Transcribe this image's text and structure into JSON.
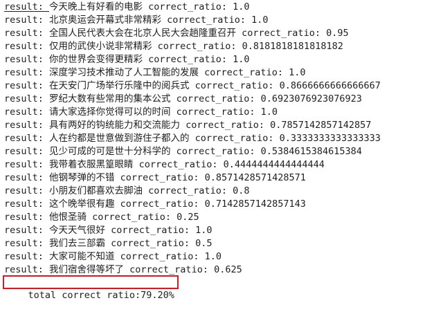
{
  "prefix": "result: ",
  "lines": [
    {
      "text": "今天晚上有好看的电影 correct_ratio: 1.0"
    },
    {
      "text": "北京奥运会开幕式非常精彩 correct_ratio: 1.0"
    },
    {
      "text": "全国人民代表大会在北京人民大会趟隆重召开 correct_ratio: 0.95"
    },
    {
      "text": "仅用的武侠小说非常精彩 correct_ratio: 0.8181818181818182"
    },
    {
      "text": "你的世界会变得更精彩 correct_ratio: 1.0"
    },
    {
      "text": "深度学习技术推动了人工智能的发展 correct_ratio: 1.0"
    },
    {
      "text": "在天安门广场举行乐隆中的阅兵式 correct_ratio: 0.8666666666666667"
    },
    {
      "text": "罗纪大数有些常用的集本公式 correct_ratio: 0.6923076923076923"
    },
    {
      "text": "请大家选择你觉得可以的时间 correct_ratio: 1.0"
    },
    {
      "text": "具有两好的钩统能力和交流能力 correct_ratio: 0.7857142857142857"
    },
    {
      "text": "人在约都是世意做到游住子都入的 correct_ratio: 0.3333333333333333"
    },
    {
      "text": "见少可成的可是世十分科学的 correct_ratio: 0.5384615384615384"
    },
    {
      "text": "我带着衣服黑篁眼睛 correct_ratio: 0.4444444444444444"
    },
    {
      "text": "他钢琴弹的不错 correct_ratio: 0.8571428571428571"
    },
    {
      "text": "小朋友们都喜欢去脚油 correct_ratio: 0.8"
    },
    {
      "text": "这个晚举很有趣 correct_ratio: 0.7142857142857143"
    },
    {
      "text": "他恨圣骑 correct_ratio: 0.25"
    },
    {
      "text": "今天天气很好 correct_ratio: 1.0"
    },
    {
      "text": "我们去三部霸 correct_ratio: 0.5"
    },
    {
      "text": "大家可能不知道 correct_ratio: 1.0"
    },
    {
      "text": "我们宿舍得等坏了 correct_ratio: 0.625"
    }
  ],
  "total": "total correct ratio:79.20%",
  "colors": {
    "highlight_border": "#e0141e",
    "text": "#1e1e1e",
    "background": "#ffffff"
  }
}
